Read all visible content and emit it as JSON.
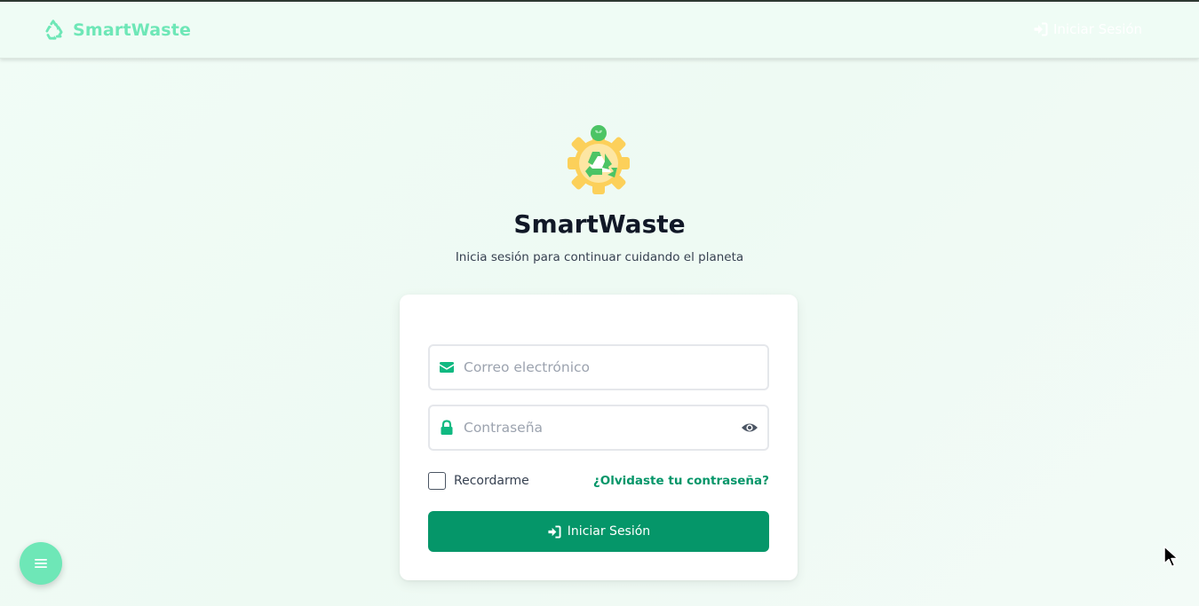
{
  "navbar": {
    "brand_icon": "recycle-icon",
    "brand_name": "SmartWaste",
    "login_icon": "sign-in-icon",
    "login_label": "Iniciar Sesión"
  },
  "hero": {
    "logo_icon": "recycle-gear-logo",
    "title": "SmartWaste",
    "subtitle": "Inicia sesión para continuar cuidando el planeta"
  },
  "form": {
    "email": {
      "icon": "envelope-icon",
      "placeholder": "Correo electrónico",
      "value": ""
    },
    "password": {
      "icon": "lock-icon",
      "placeholder": "Contraseña",
      "value": "",
      "toggle_icon": "eye-icon"
    },
    "remember_label": "Recordarme",
    "remember_checked": false,
    "forgot_label": "¿Olvidaste tu contraseña?",
    "submit_icon": "sign-in-icon",
    "submit_label": "Iniciar Sesión"
  },
  "fab": {
    "icon": "menu-icon"
  },
  "colors": {
    "primary": "#059669",
    "brand_light": "#6ee7b7",
    "background": "#effcf5",
    "logo_gear": "#fcd05a",
    "logo_arrows": "#4cc465"
  }
}
